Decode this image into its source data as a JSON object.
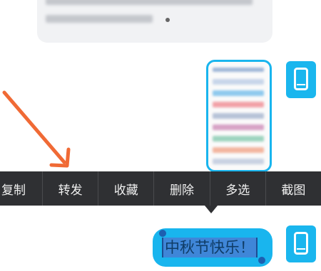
{
  "context_menu": {
    "items": [
      {
        "label": "复制"
      },
      {
        "label": "转发"
      },
      {
        "label": "收藏"
      },
      {
        "label": "删除"
      },
      {
        "label": "多选"
      },
      {
        "label": "截图"
      }
    ]
  },
  "message": {
    "selected_text": "中秋节快乐！"
  },
  "colors": {
    "accent": "#19b5ee",
    "menu_bg": "#2f3033",
    "arrow": "#f06a35",
    "selection": "#3f86d8"
  },
  "icons": {
    "avatar": "phone-icon",
    "pointer": "arrow-icon"
  }
}
